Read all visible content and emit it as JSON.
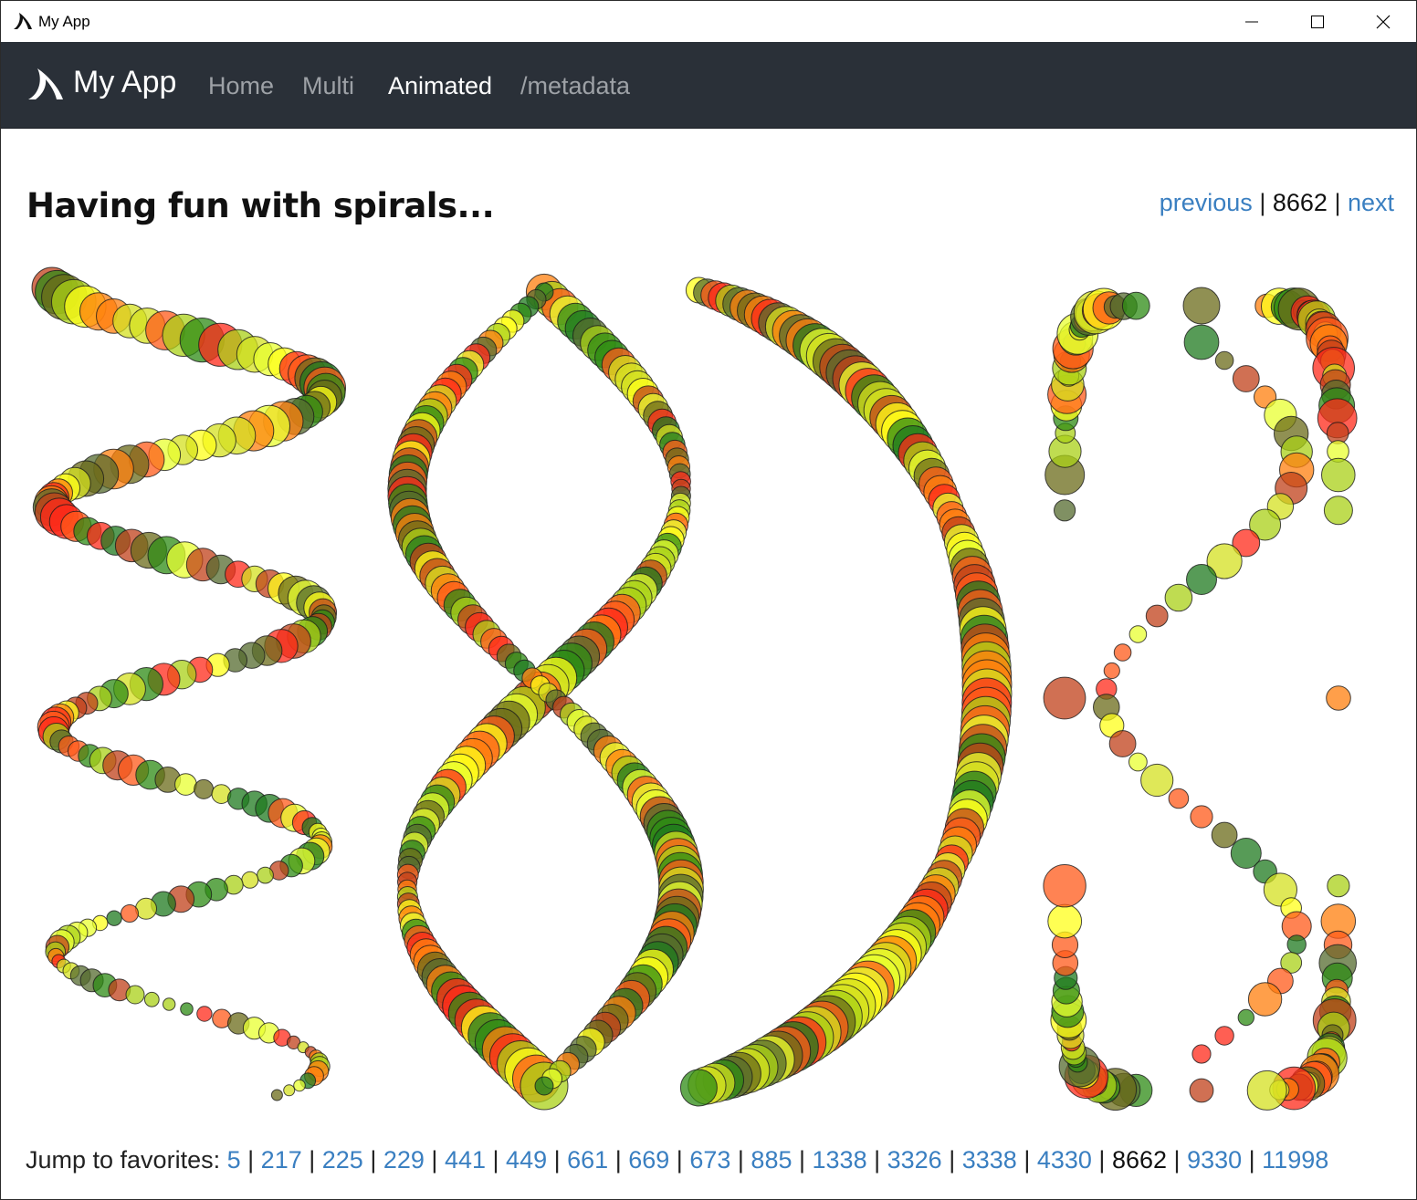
{
  "window": {
    "title": "My App"
  },
  "navbar": {
    "brand": "My App",
    "links": [
      {
        "label": "Home",
        "active": false
      },
      {
        "label": "Multi",
        "active": false
      },
      {
        "label": "Animated",
        "active": true
      },
      {
        "label": "/metadata",
        "active": false
      }
    ]
  },
  "page": {
    "title": "Having fun with spirals...",
    "pager": {
      "previous": "previous",
      "current": "8662",
      "next": "next"
    },
    "favorites": {
      "label": "Jump to favorites:",
      "items": [
        "5",
        "217",
        "225",
        "229",
        "441",
        "449",
        "661",
        "669",
        "673",
        "885",
        "1338",
        "3326",
        "3338",
        "4330",
        "8662",
        "9330",
        "11998"
      ],
      "current": "8662"
    }
  },
  "colors": {
    "titlebar": "#ffffff",
    "navbar": "#2a3038",
    "link": "#3a7fc1",
    "marker_palette": [
      "#ff2a1a",
      "#ff7f0e",
      "#ffff1a",
      "#aad017",
      "#2e8b14",
      "#6b6b1a",
      "#c0401a",
      "#ff5a1a",
      "#d4e020",
      "#1f7a1f",
      "#556b2f",
      "#e8ff30"
    ]
  },
  "icons": {
    "app": "shark-fin-icon",
    "minimize": "minimize-icon",
    "maximize": "maximize-icon",
    "close": "close-icon"
  }
}
